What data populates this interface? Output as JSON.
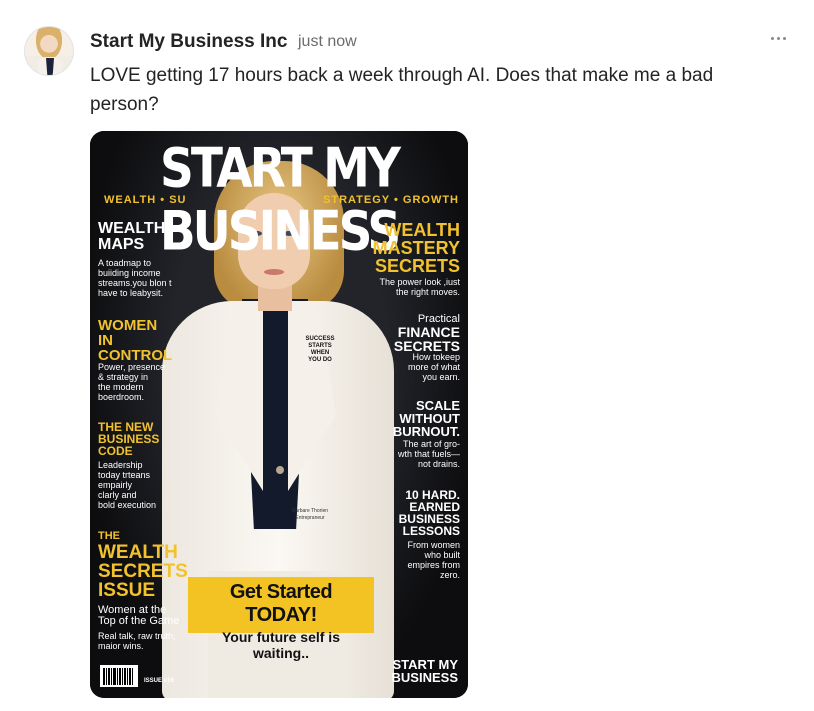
{
  "post": {
    "author": "Start My Business Inc",
    "timestamp": "just now",
    "message": "LOVE getting 17 hours back a week through AI. Does that make me a bad person?",
    "more_label": "More options"
  },
  "cover": {
    "masthead": "START MY BUSINESS",
    "tagline_left": "WEALTH • SU",
    "tagline_right": "STRATEGY • GROWTH",
    "left": {
      "h1": "WEALTH\nMAPS",
      "h1_sub": "A toadmap to\nbuiiding income\nstreams.you blon t\nhave to leabysit.",
      "h2": "WOMEN\nIN\nCONTROL",
      "h2_sub": "Power, presence\n& strategy in\nthe modern\nboerdroom.",
      "h3": "THE NEW\nBUSINESS\nCODE",
      "h3_sub": "Leadership\ntoday trteans\nempairly\nclarly and\nbold execution",
      "h4_small": "THE",
      "h4": "WEALTH\nSECRETS\nISSUE",
      "h4_sub": "Women at the\nTop of the Game",
      "h4_sub2": "Real talk, raw truth,\nmaior wins."
    },
    "right": {
      "h1": "WEALTH\nMASTERY\nSECRETS",
      "h1_sub": "The power look ,iust\nthe right moves.",
      "h2_small": "Practical",
      "h2": "FINANCE\nSECRETS",
      "h2_sub": "How tokeep\nmore of what\nyou earn.",
      "h3": "SCALE\nWITHOUT\nBURNOUT.",
      "h3_sub": "The art of gro-\nwth that fuels—\nnot drains.",
      "h4": "10 HARD.\nEARNED\nBUSINESS\nLESSONS",
      "h4_sub": "From women\nwho built\nempires from\nzero.",
      "footer": "START MY\nBUSINESS"
    },
    "pin": "SUCCESS\nSTARTS\nWHEN\nYOU DO",
    "badge": "Barbare Thorien\nEntrepraneur",
    "cta_title": "Get Started TODAY!",
    "cta_sub": "Your future self is waiting..",
    "issue": "ISSUE #16"
  }
}
